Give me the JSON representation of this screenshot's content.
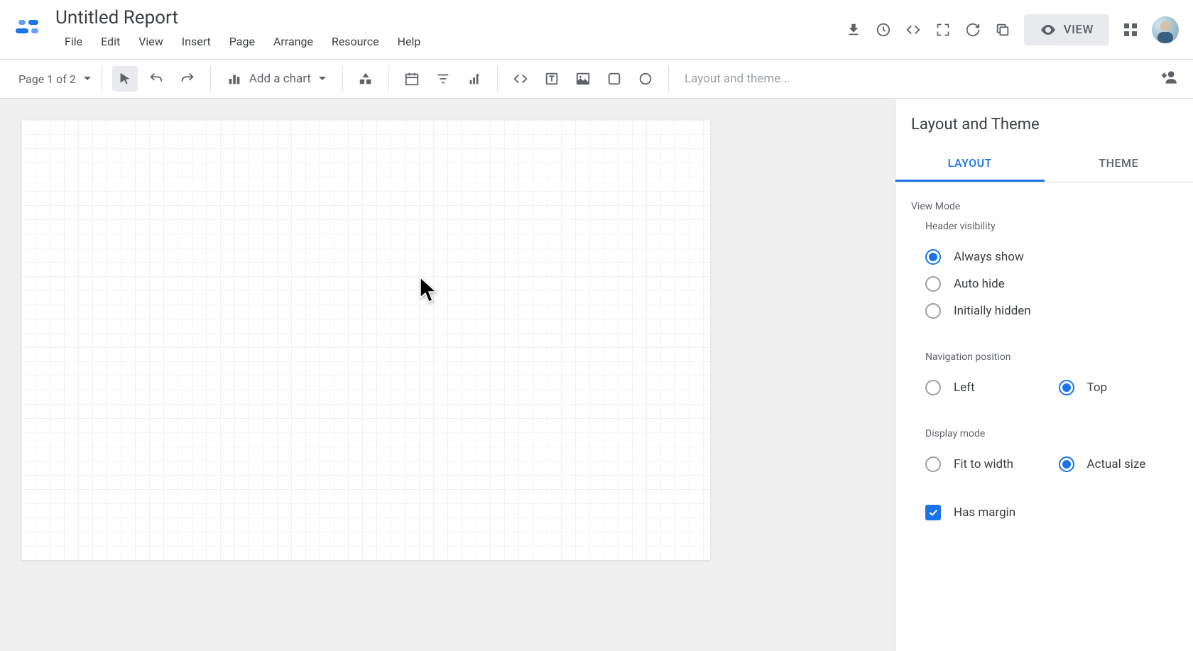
{
  "header": {
    "title": "Untitled Report",
    "menus": [
      "File",
      "Edit",
      "View",
      "Insert",
      "Page",
      "Arrange",
      "Resource",
      "Help"
    ],
    "view_button": "VIEW"
  },
  "toolbar": {
    "page_label": "Page 1 of 2",
    "add_chart": "Add a chart",
    "layout_placeholder": "Layout and theme..."
  },
  "side_panel": {
    "title": "Layout and Theme",
    "tabs": {
      "layout": "LAYOUT",
      "theme": "THEME"
    },
    "view_mode": {
      "section_label": "View Mode",
      "header_visibility": {
        "label": "Header visibility",
        "options": [
          "Always show",
          "Auto hide",
          "Initially hidden"
        ],
        "selected": "Always show"
      },
      "navigation_position": {
        "label": "Navigation position",
        "options": [
          "Left",
          "Top"
        ],
        "selected": "Top"
      },
      "display_mode": {
        "label": "Display mode",
        "options": [
          "Fit to width",
          "Actual size"
        ],
        "selected": "Actual size"
      },
      "has_margin": {
        "label": "Has margin",
        "checked": true
      }
    }
  },
  "colors": {
    "accent": "#1a73e8"
  }
}
